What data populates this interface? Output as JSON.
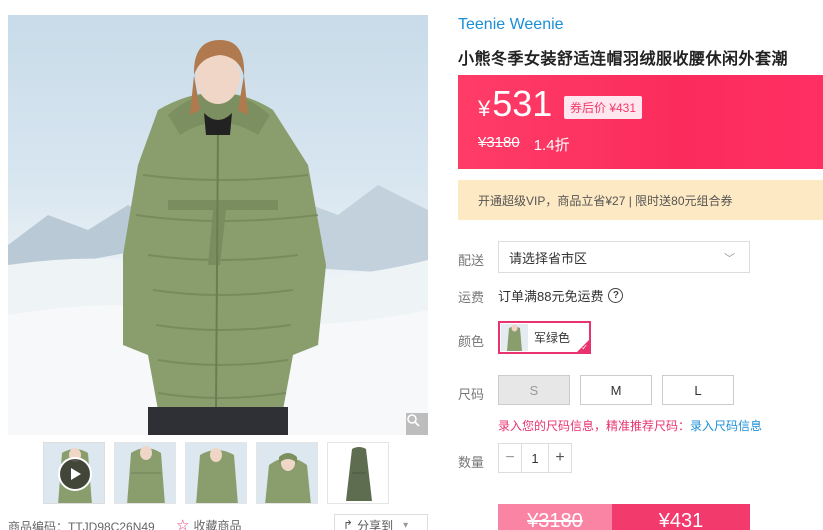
{
  "product": {
    "brand": "Teenie Weenie",
    "title": "小熊冬季女装舒适连帽羽绒服收腰休闲外套潮"
  },
  "price": {
    "currency": "¥",
    "current": "531",
    "coupon_label": "券后价 ¥431",
    "original": "¥3180",
    "discount": "1.4折"
  },
  "vip_banner": "开通超级VIP，商品立省¥27 | 限时送80元组合券",
  "delivery": {
    "label": "配送",
    "placeholder": "请选择省市区"
  },
  "shipping": {
    "label": "运费",
    "text": "订单满88元免运费"
  },
  "color": {
    "label": "颜色",
    "options": [
      "军绿色"
    ]
  },
  "size": {
    "label": "尺码",
    "options": [
      "S",
      "M",
      "L"
    ],
    "recommend_text": "录入您的尺码信息，精准推荐尺码：",
    "recommend_link": "录入尺码信息"
  },
  "quantity": {
    "label": "数量",
    "value": "1",
    "minus": "−",
    "plus": "+"
  },
  "buy": {
    "old_price": "¥3180",
    "new_price": "¥431"
  },
  "meta": {
    "sku": "商品编码：TTJD98C26N49",
    "favorite": "收藏商品",
    "share": "分享到"
  },
  "colors": {
    "accent": "#f23a6c",
    "brand_blue": "#1a8fd6",
    "coat_green": "#8a9e6d"
  }
}
